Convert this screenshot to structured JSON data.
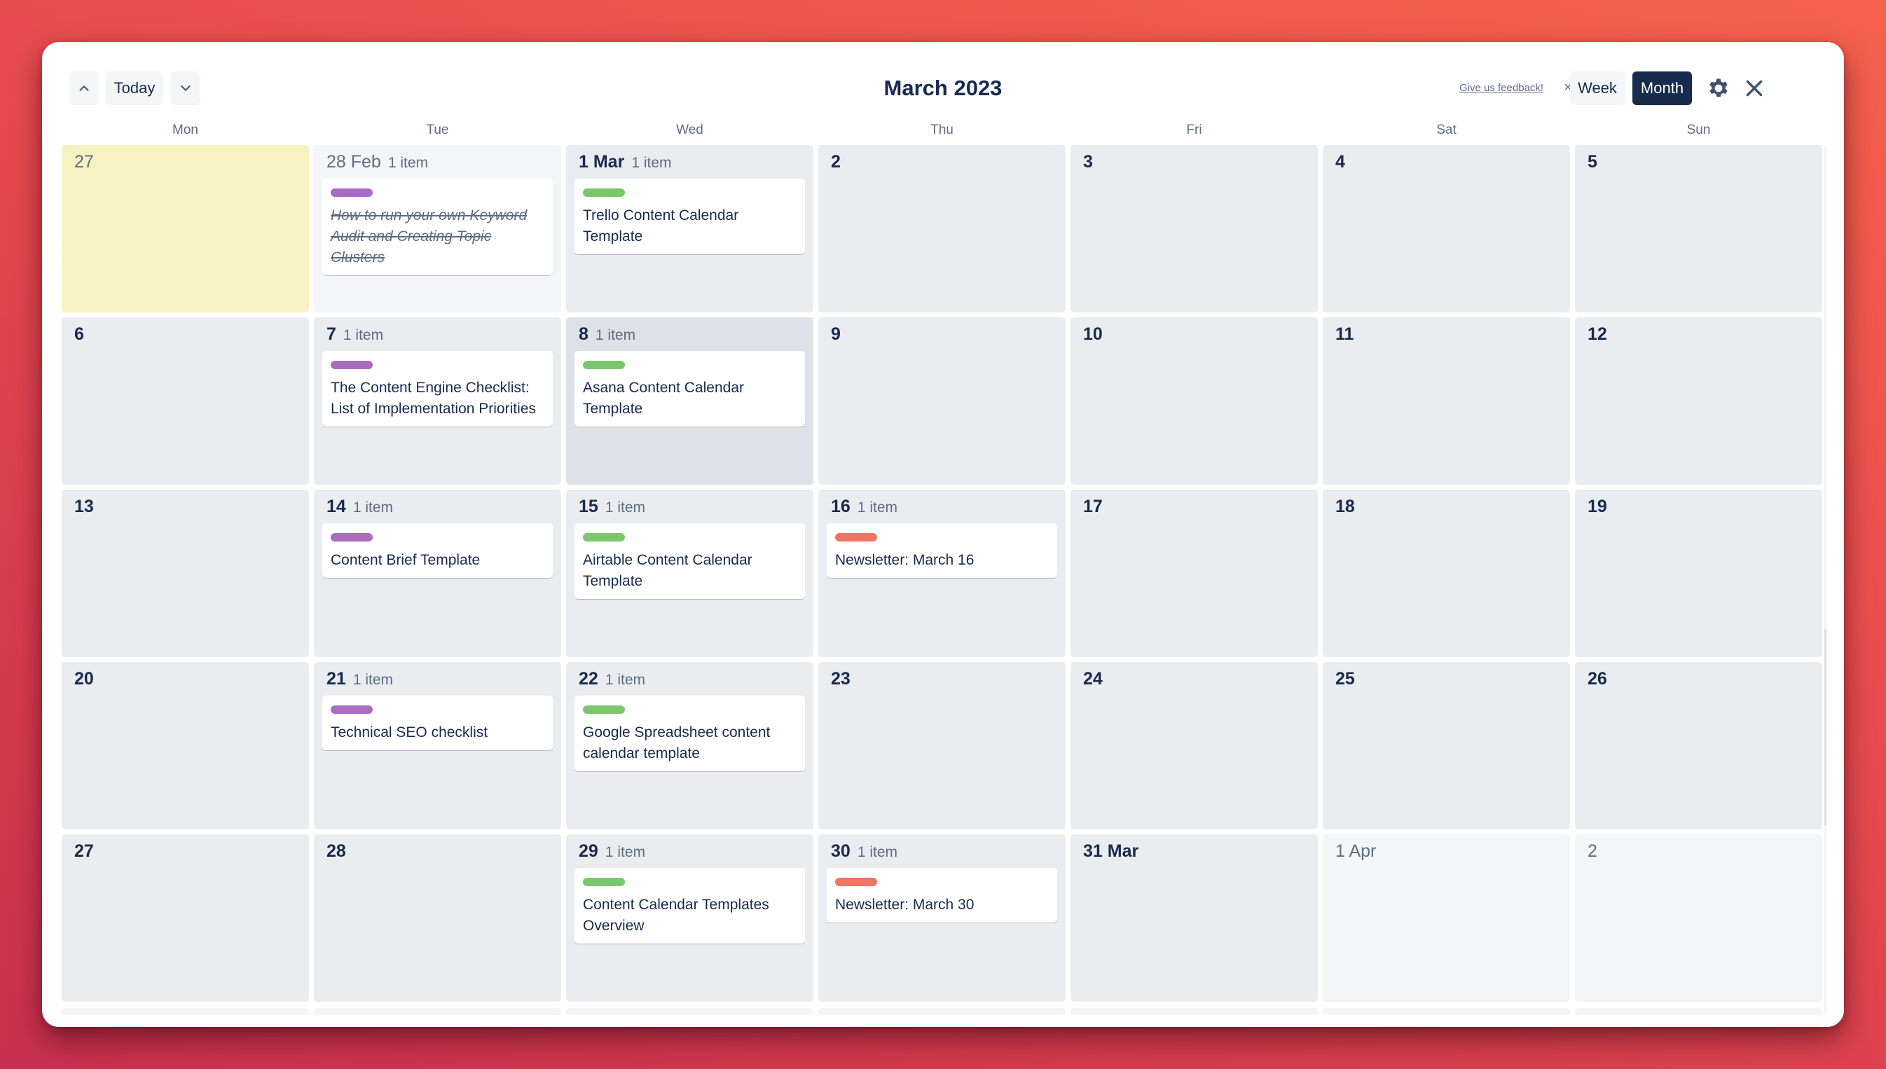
{
  "header": {
    "prev_label": "previous",
    "today_label": "Today",
    "next_label": "next",
    "title": "March 2023",
    "feedback_link": "Give us feedback!",
    "feedback_dismiss": "×",
    "view_week": "Week",
    "view_month": "Month",
    "active_view": "Month"
  },
  "weekdays": [
    "Mon",
    "Tue",
    "Wed",
    "Thu",
    "Fri",
    "Sat",
    "Sun"
  ],
  "label_colors": {
    "purple": "#a86cc1",
    "green": "#7bc86c",
    "red": "#ef7564"
  },
  "weeks": [
    [
      {
        "date": "27",
        "state": "today",
        "count": "",
        "cards": []
      },
      {
        "date": "28 Feb",
        "state": "outside",
        "count": "1 item",
        "cards": [
          {
            "label": "purple",
            "title": "How to run your own Keyword Audit and Creating Topic Clusters",
            "done": true
          }
        ]
      },
      {
        "date": "1 Mar",
        "state": "",
        "count": "1 item",
        "cards": [
          {
            "label": "green",
            "title": "Trello Content Calendar Template",
            "done": false
          }
        ]
      },
      {
        "date": "2",
        "state": "",
        "count": "",
        "cards": []
      },
      {
        "date": "3",
        "state": "",
        "count": "",
        "cards": []
      },
      {
        "date": "4",
        "state": "",
        "count": "",
        "cards": []
      },
      {
        "date": "5",
        "state": "",
        "count": "",
        "cards": []
      }
    ],
    [
      {
        "date": "6",
        "state": "",
        "count": "",
        "cards": []
      },
      {
        "date": "7",
        "state": "",
        "count": "1 item",
        "cards": [
          {
            "label": "purple",
            "title": "The Content Engine Checklist: List of Implementation Priorities",
            "done": false
          }
        ]
      },
      {
        "date": "8",
        "state": "hover",
        "count": "1 item",
        "cards": [
          {
            "label": "green",
            "title": "Asana Content Calendar Template",
            "done": false
          }
        ]
      },
      {
        "date": "9",
        "state": "",
        "count": "",
        "cards": []
      },
      {
        "date": "10",
        "state": "",
        "count": "",
        "cards": []
      },
      {
        "date": "11",
        "state": "",
        "count": "",
        "cards": []
      },
      {
        "date": "12",
        "state": "",
        "count": "",
        "cards": []
      }
    ],
    [
      {
        "date": "13",
        "state": "",
        "count": "",
        "cards": []
      },
      {
        "date": "14",
        "state": "",
        "count": "1 item",
        "cards": [
          {
            "label": "purple",
            "title": "Content Brief Template",
            "done": false
          }
        ]
      },
      {
        "date": "15",
        "state": "",
        "count": "1 item",
        "cards": [
          {
            "label": "green",
            "title": "Airtable Content Calendar Template",
            "done": false
          }
        ]
      },
      {
        "date": "16",
        "state": "",
        "count": "1 item",
        "cards": [
          {
            "label": "red",
            "title": "Newsletter: March 16",
            "done": false
          }
        ]
      },
      {
        "date": "17",
        "state": "",
        "count": "",
        "cards": []
      },
      {
        "date": "18",
        "state": "",
        "count": "",
        "cards": []
      },
      {
        "date": "19",
        "state": "",
        "count": "",
        "cards": []
      }
    ],
    [
      {
        "date": "20",
        "state": "",
        "count": "",
        "cards": []
      },
      {
        "date": "21",
        "state": "",
        "count": "1 item",
        "cards": [
          {
            "label": "purple",
            "title": "Technical SEO checklist",
            "done": false
          }
        ]
      },
      {
        "date": "22",
        "state": "",
        "count": "1 item",
        "cards": [
          {
            "label": "green",
            "title": "Google Spreadsheet content calendar template",
            "done": false
          }
        ]
      },
      {
        "date": "23",
        "state": "",
        "count": "",
        "cards": []
      },
      {
        "date": "24",
        "state": "",
        "count": "",
        "cards": []
      },
      {
        "date": "25",
        "state": "",
        "count": "",
        "cards": []
      },
      {
        "date": "26",
        "state": "",
        "count": "",
        "cards": []
      }
    ],
    [
      {
        "date": "27",
        "state": "",
        "count": "",
        "cards": []
      },
      {
        "date": "28",
        "state": "",
        "count": "",
        "cards": []
      },
      {
        "date": "29",
        "state": "",
        "count": "1 item",
        "cards": [
          {
            "label": "green",
            "title": "Content Calendar Templates Overview",
            "done": false
          }
        ]
      },
      {
        "date": "30",
        "state": "",
        "count": "1 item",
        "cards": [
          {
            "label": "red",
            "title": "Newsletter: March 30",
            "done": false
          }
        ]
      },
      {
        "date": "31 Mar",
        "state": "",
        "count": "",
        "cards": []
      },
      {
        "date": "1 Apr",
        "state": "outside",
        "count": "",
        "cards": []
      },
      {
        "date": "2",
        "state": "outside",
        "count": "",
        "cards": []
      }
    ]
  ]
}
